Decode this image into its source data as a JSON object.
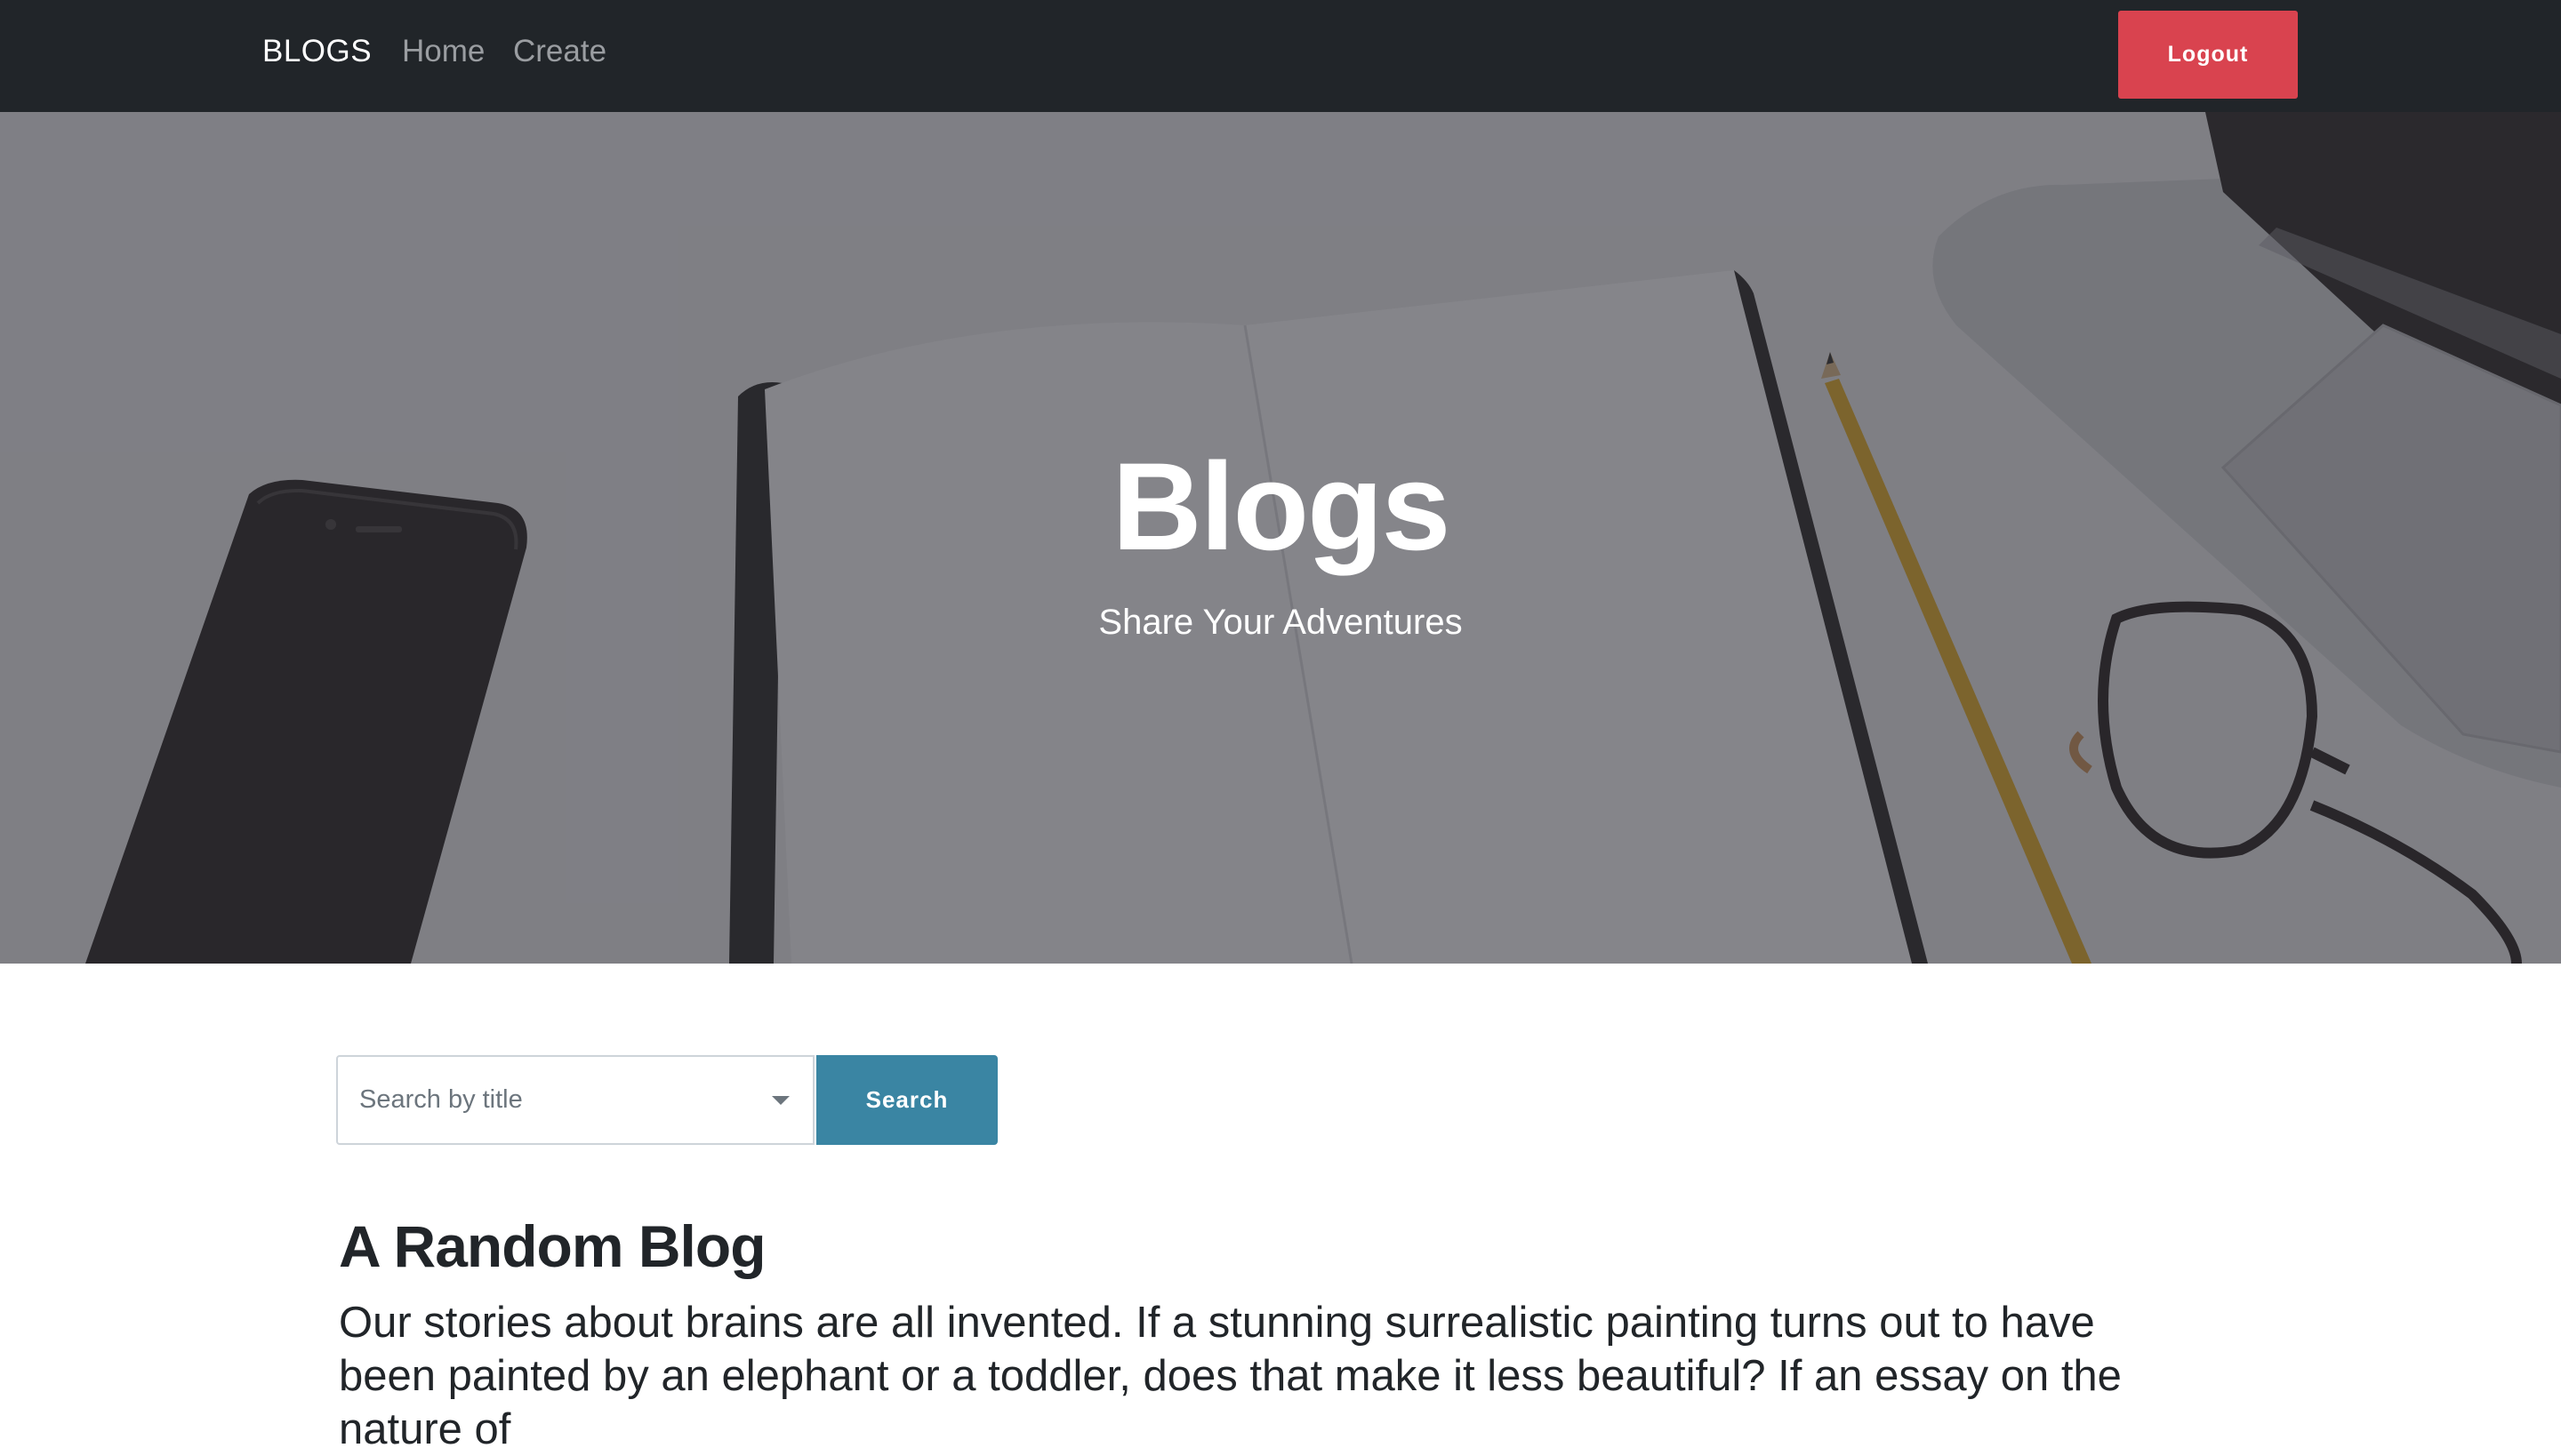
{
  "navbar": {
    "brand": "BLOGS",
    "links": [
      {
        "label": "Home"
      },
      {
        "label": "Create"
      }
    ],
    "logout_label": "Logout"
  },
  "hero": {
    "title": "Blogs",
    "subtitle": "Share Your Adventures"
  },
  "search": {
    "placeholder": "Search by title",
    "button_label": "Search"
  },
  "posts": [
    {
      "title": "A Random Blog",
      "body": "Our stories about brains are all invented. If a stunning surrealistic painting turns out to have been painted by an elephant or a toddler, does that make it less beautiful? If an essay on the nature of"
    }
  ],
  "colors": {
    "navbar_bg": "#212529",
    "logout_bg": "#d9434f",
    "search_button_bg": "#3a85a3"
  }
}
